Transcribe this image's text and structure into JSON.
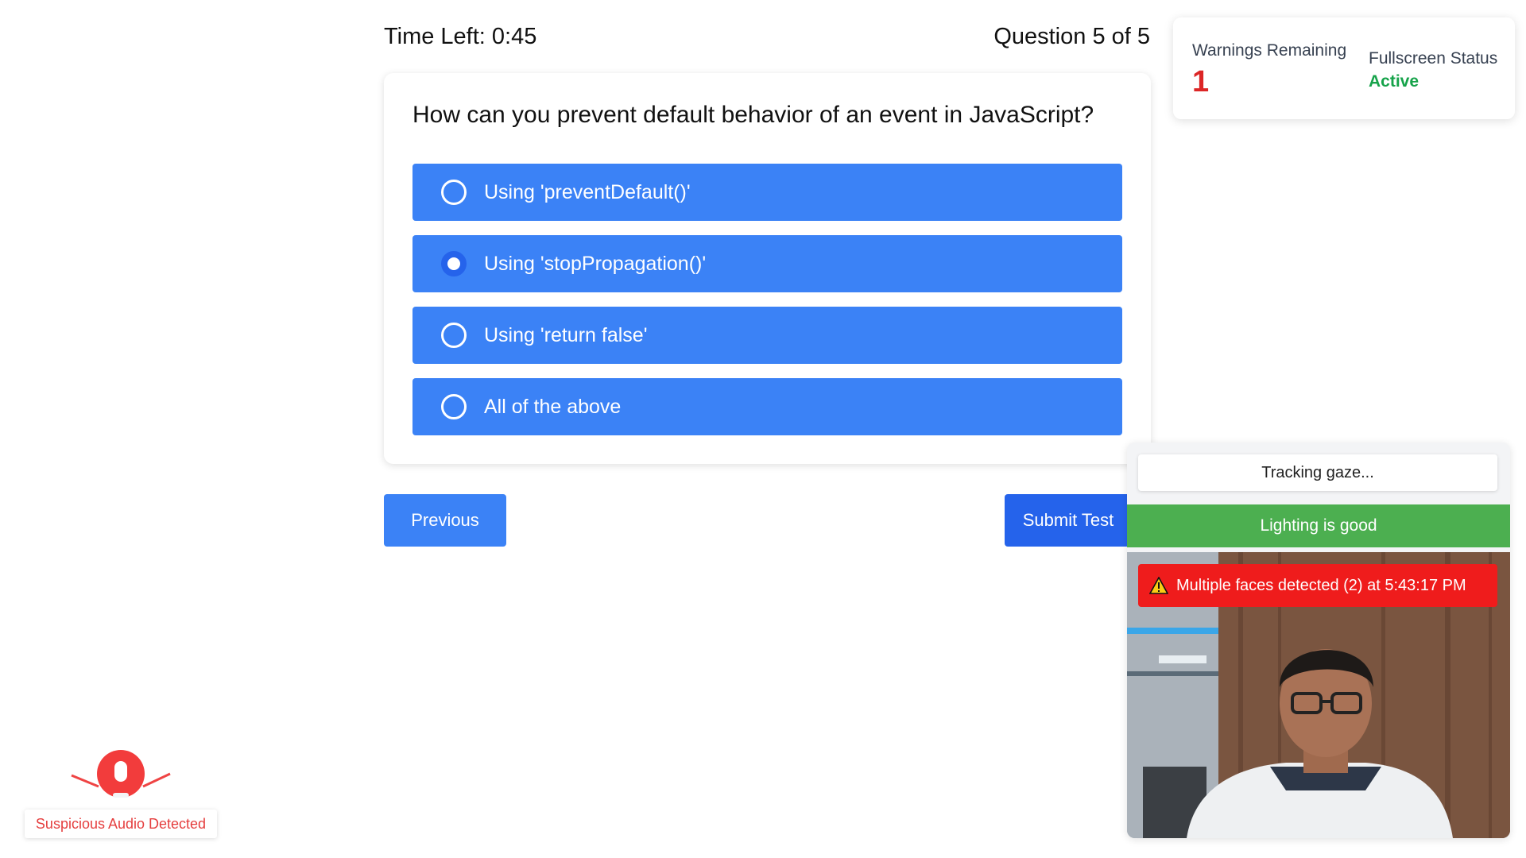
{
  "header": {
    "timer": "Time Left: 0:45",
    "question_count": "Question 5 of 5"
  },
  "quiz": {
    "question": "How can you prevent default behavior of an event in JavaScript?",
    "options": [
      {
        "label": "Using 'preventDefault()'",
        "selected": false
      },
      {
        "label": "Using 'stopPropagation()'",
        "selected": true
      },
      {
        "label": "Using 'return false'",
        "selected": false
      },
      {
        "label": "All of the above",
        "selected": false
      }
    ],
    "accent_color": "#3b82f6"
  },
  "nav": {
    "previous_label": "Previous",
    "submit_label": "Submit Test"
  },
  "status": {
    "warnings_label": "Warnings Remaining",
    "warnings_value": "1",
    "fullscreen_label": "Fullscreen Status",
    "fullscreen_value": "Active"
  },
  "proctor": {
    "gaze_text": "Tracking gaze...",
    "lighting_text": "Lighting is good",
    "alert_text": "Multiple faces detected (2) at 5:43:17 PM",
    "alert_icon": "warning-icon"
  },
  "audio": {
    "text": "Suspicious Audio Detected",
    "icon": "microphone-icon"
  }
}
